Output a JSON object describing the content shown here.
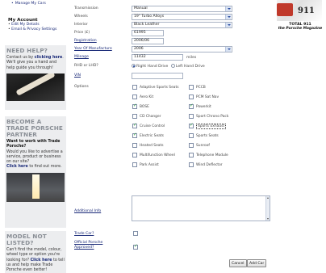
{
  "sidebar": {
    "top_link": "Manage My Cars",
    "account": {
      "heading": "My Account",
      "links": [
        "Edit My Details",
        "Email & Privacy Settings"
      ]
    },
    "help": {
      "title": "NEED HELP?",
      "line1": "Contact us by ",
      "link1": "clicking here",
      "line2": ". We'll give you a hand and help guide you through!"
    },
    "trade": {
      "title": "BECOME A TRADE PORSCHE PARTNER",
      "question": "Want to work with Trade Porsche?",
      "body": "Would you like to advertise a service, product or business on our site?",
      "link": "Click here",
      "tail": " to find out more."
    },
    "model": {
      "title": "MODEL NOT LISTED?",
      "body1": "Can't find the model, colour, wheel type or option you're looking for?",
      "link": "Click here",
      "body2": " to tell us and help make Trade Porsche even better!"
    }
  },
  "form": {
    "transmission": {
      "label": "Transmission",
      "value": "Manual"
    },
    "wheels": {
      "label": "Wheels",
      "value": "19\" Turbo Alloys"
    },
    "interior": {
      "label": "Interior",
      "value": "Black Leather"
    },
    "price": {
      "label": "Price (£)",
      "value": "61995"
    },
    "registration": {
      "label": "Registration",
      "value": "2006/06"
    },
    "year": {
      "label": "Year Of Manufacture",
      "value": "2006"
    },
    "mileage": {
      "label": "Mileage",
      "value": "11432",
      "unit": "miles"
    },
    "drive": {
      "label": "RHD or LHD?",
      "options": [
        "Right Hand Drive",
        "Left Hand Drive"
      ],
      "selected": "Right Hand Drive"
    },
    "vin": {
      "label": "VIN",
      "value": ""
    },
    "options_label": "Options",
    "options": [
      {
        "label": "Adaptive Sports Seats",
        "checked": false
      },
      {
        "label": "PCCB",
        "checked": false
      },
      {
        "label": "Aero Kit",
        "checked": false
      },
      {
        "label": "PCM Sat Nav",
        "checked": false
      },
      {
        "label": "BOSE",
        "checked": true
      },
      {
        "label": "Powerkit",
        "checked": true
      },
      {
        "label": "CD Changer",
        "checked": false
      },
      {
        "label": "Sport Chrono Pack",
        "checked": false
      },
      {
        "label": "Cruise Control",
        "checked": true
      },
      {
        "label": "Sports Exhaust",
        "checked": true
      },
      {
        "label": "Electric Seats",
        "checked": true
      },
      {
        "label": "Sports Seats",
        "checked": false
      },
      {
        "label": "Heated Seats",
        "checked": false
      },
      {
        "label": "Sunroof",
        "checked": false
      },
      {
        "label": "Multifunction Wheel",
        "checked": false
      },
      {
        "label": "Telephone Module",
        "checked": false
      },
      {
        "label": "Park Assist",
        "checked": false
      },
      {
        "label": "Wind Deflector",
        "checked": false
      }
    ],
    "additional_info": {
      "label": "Additional Info",
      "value": ""
    },
    "trade_car": {
      "label": "Trade Car?",
      "checked": false
    },
    "official": {
      "label": "Official Porsche Approved?",
      "checked": true
    },
    "buttons": {
      "cancel": "Cancel",
      "add": "Add Car"
    }
  },
  "ad": {
    "line1": "TOTAL 911",
    "line2": "the Porsche Magazine"
  }
}
